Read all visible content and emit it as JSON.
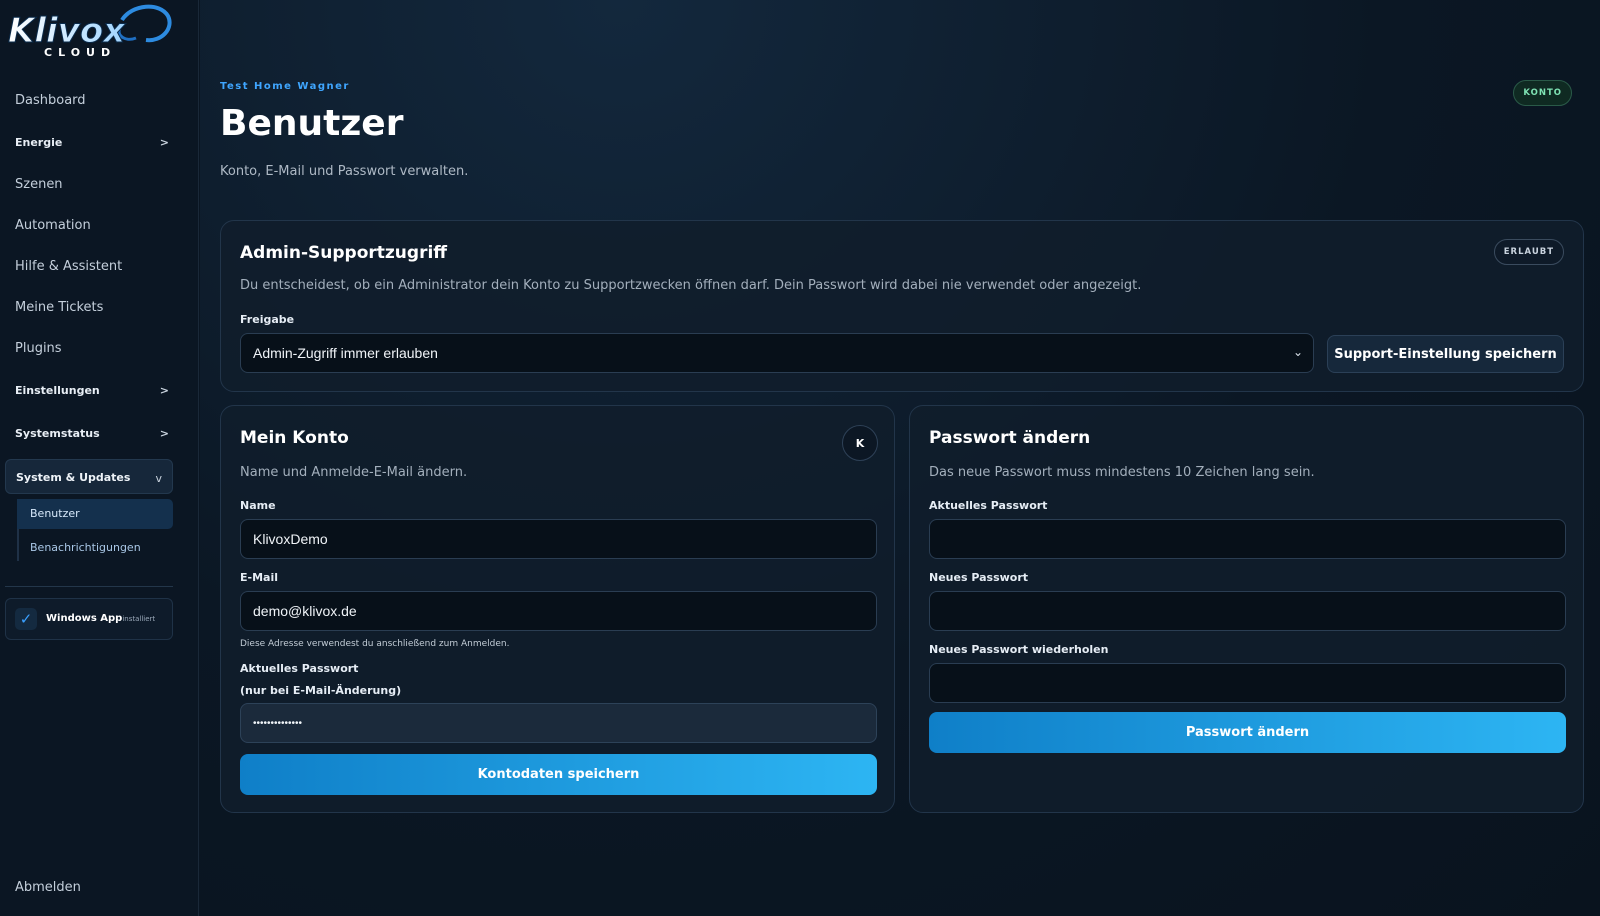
{
  "brand": {
    "logo_text": "Klivox",
    "logo_sub": "CLOUD"
  },
  "sidebar": {
    "items": [
      {
        "label": "Dashboard"
      },
      {
        "label": "Energie",
        "chevron": ">"
      },
      {
        "label": "Szenen"
      },
      {
        "label": "Automation"
      },
      {
        "label": "Hilfe & Assistent"
      },
      {
        "label": "Meine Tickets"
      },
      {
        "label": "Plugins"
      },
      {
        "label": "Einstellungen",
        "chevron": ">"
      },
      {
        "label": "Systemstatus",
        "chevron": ">"
      }
    ],
    "group": {
      "label": "System & Updates",
      "chevron": "v"
    },
    "subitems": [
      {
        "label": "Benutzer"
      },
      {
        "label": "Benachrichtigungen"
      }
    ],
    "app_badge": {
      "label": "Windows App",
      "sub": "installiert",
      "icon": "check-icon"
    },
    "logout": "Abmelden"
  },
  "header": {
    "eyebrow": "Test Home Wagner",
    "title": "Benutzer",
    "subtitle": "Konto, E-Mail und Passwort verwalten.",
    "badge": "KONTO"
  },
  "support_card": {
    "title": "Admin-Supportzugriff",
    "badge": "ERLAUBT",
    "description": "Du entscheidest, ob ein Administrator dein Konto zu Supportzwecken öffnen darf. Dein Passwort wird dabei nie verwendet oder angezeigt.",
    "field_label": "Freigabe",
    "select_value": "Admin-Zugriff immer erlauben",
    "save_button": "Support-Einstellung speichern"
  },
  "account_card": {
    "title": "Mein Konto",
    "avatar_letter": "K",
    "subtitle": "Name und Anmelde-E-Mail ändern.",
    "name_label": "Name",
    "name_value": "KlivoxDemo",
    "email_label": "E-Mail",
    "email_value": "demo@klivox.de",
    "email_hint": "Diese Adresse verwendest du anschließend zum Anmelden.",
    "password_label": "Aktuelles Passwort",
    "password_sublabel": "(nur bei E-Mail-Änderung)",
    "password_value": "••••••••••••••",
    "save_button": "Kontodaten speichern"
  },
  "password_card": {
    "title": "Passwort ändern",
    "subtitle": "Das neue Passwort muss mindestens 10 Zeichen lang sein.",
    "current_label": "Aktuelles Passwort",
    "new_label": "Neues Passwort",
    "repeat_label": "Neues Passwort wiederholen",
    "submit_button": "Passwort ändern"
  },
  "colors": {
    "accent": "#2db5f3",
    "eyebrow": "#3fa6ff",
    "success": "#7fe3b4",
    "background": "#0a1522"
  }
}
